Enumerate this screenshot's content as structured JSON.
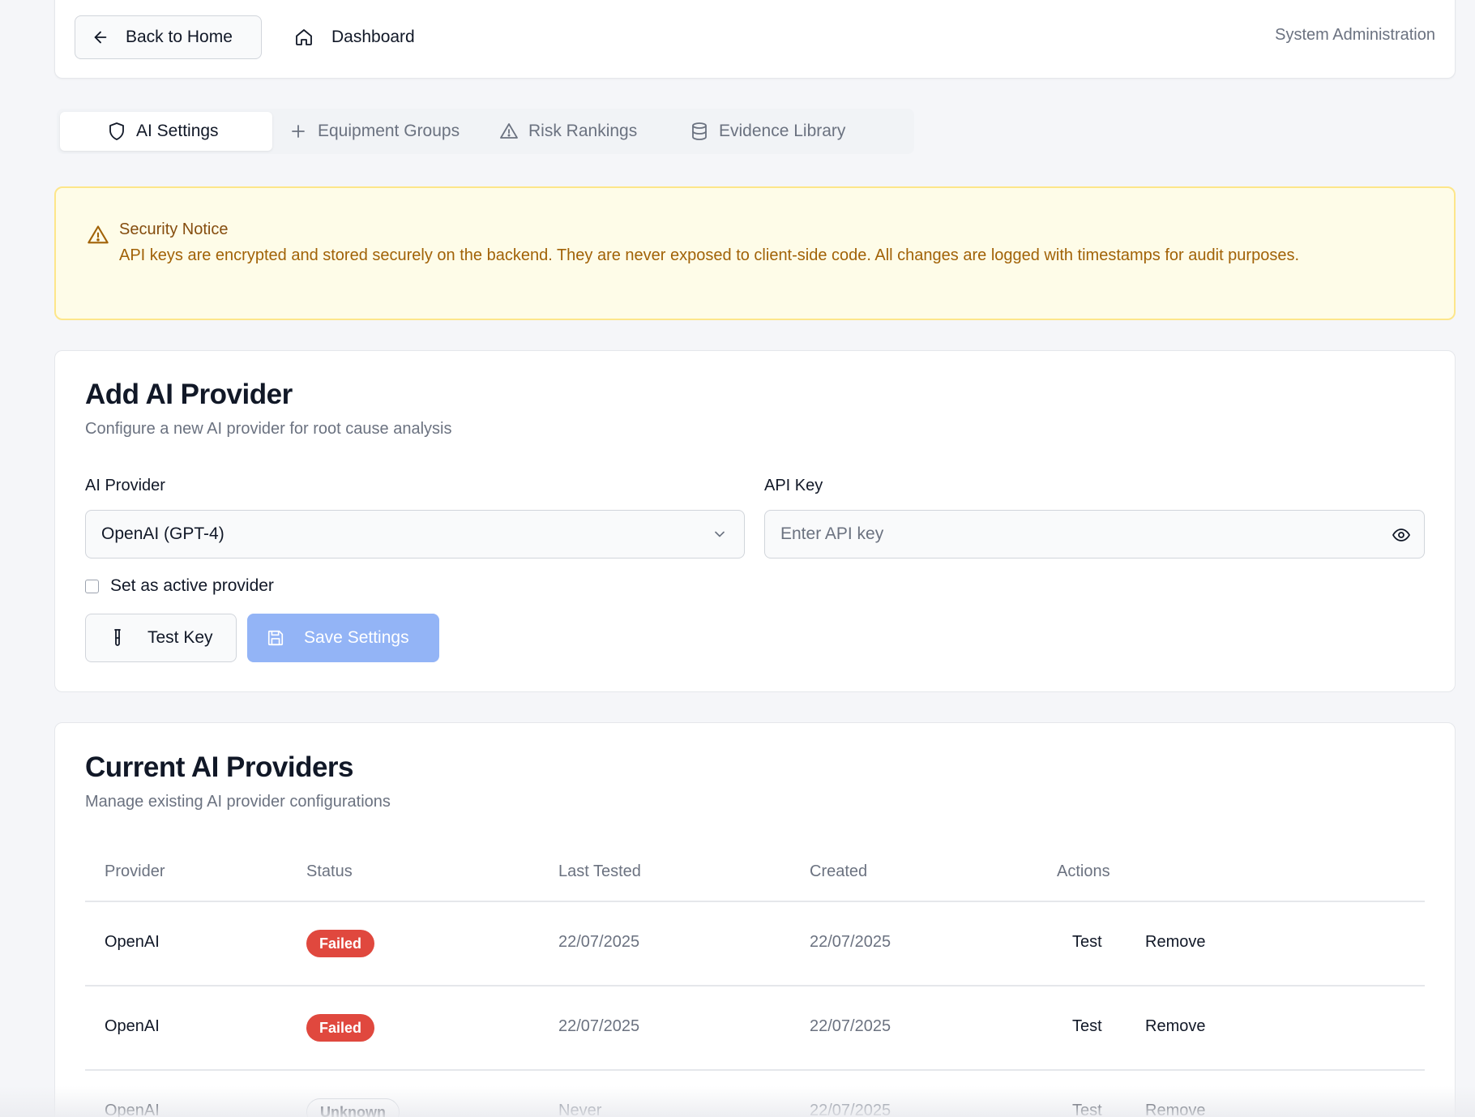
{
  "header": {
    "back_label": "Back to Home",
    "dashboard_label": "Dashboard",
    "section_label": "System Administration"
  },
  "tabs": [
    {
      "label": "AI Settings",
      "icon": "shield-icon",
      "active": true
    },
    {
      "label": "Equipment Groups",
      "icon": "plus-icon",
      "active": false
    },
    {
      "label": "Risk Rankings",
      "icon": "alert-triangle-icon",
      "active": false
    },
    {
      "label": "Evidence Library",
      "icon": "database-icon",
      "active": false
    }
  ],
  "notice": {
    "title": "Security Notice",
    "body": "API keys are encrypted and stored securely on the backend. They are never exposed to client-side code. All changes are logged with timestamps for audit purposes.",
    "icon": "alert-triangle-icon"
  },
  "add_provider": {
    "title": "Add AI Provider",
    "subtitle": "Configure a new AI provider for root cause analysis",
    "provider_label": "AI Provider",
    "provider_value": "OpenAI (GPT-4)",
    "api_key_label": "API Key",
    "api_key_placeholder": "Enter API key",
    "api_key_value": "",
    "active_checkbox_label": "Set as active provider",
    "active_checked": false,
    "test_button": "Test Key",
    "save_button": "Save Settings"
  },
  "providers": {
    "title": "Current AI Providers",
    "subtitle": "Manage existing AI provider configurations",
    "columns": [
      "Provider",
      "Status",
      "Last Tested",
      "Created",
      "Actions"
    ],
    "rows": [
      {
        "provider": "OpenAI",
        "status": "Failed",
        "last_tested": "22/07/2025",
        "created": "22/07/2025",
        "test": "Test",
        "remove": "Remove"
      },
      {
        "provider": "OpenAI",
        "status": "Failed",
        "last_tested": "22/07/2025",
        "created": "22/07/2025",
        "test": "Test",
        "remove": "Remove"
      },
      {
        "provider": "OpenAI",
        "status": "Unknown",
        "last_tested": "Never",
        "created": "22/07/2025",
        "test": "Test",
        "remove": "Remove"
      }
    ]
  },
  "colors": {
    "failed_badge": "#e0483e",
    "save_button_disabled": "#93b4f6",
    "notice_bg": "#fefce8",
    "notice_text": "#a16207"
  }
}
